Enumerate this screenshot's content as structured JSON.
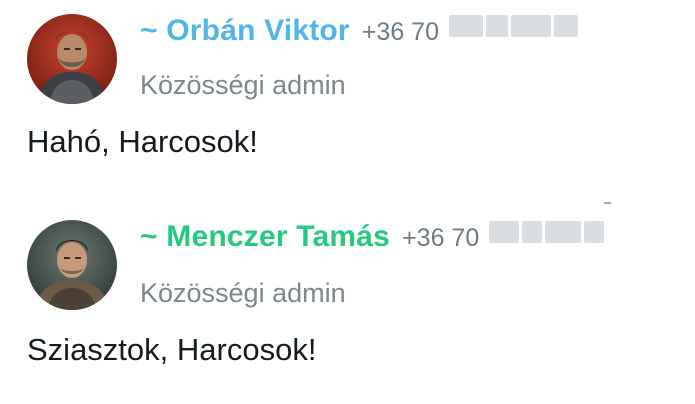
{
  "messages": [
    {
      "sender": "~ Orbán Viktor",
      "phone": "+36 70",
      "role": "Közösségi admin",
      "text": "Hahó, Harcosok!",
      "name_color": "#53b4e6",
      "avatar_icon": "avatar-warrior-image"
    },
    {
      "sender": "~ Menczer Tamás",
      "phone": "+36 70",
      "role": "Közösségi admin",
      "text": "Sziasztok, Harcosok!",
      "name_color": "#25c97f",
      "avatar_icon": "avatar-soldier-image"
    }
  ]
}
